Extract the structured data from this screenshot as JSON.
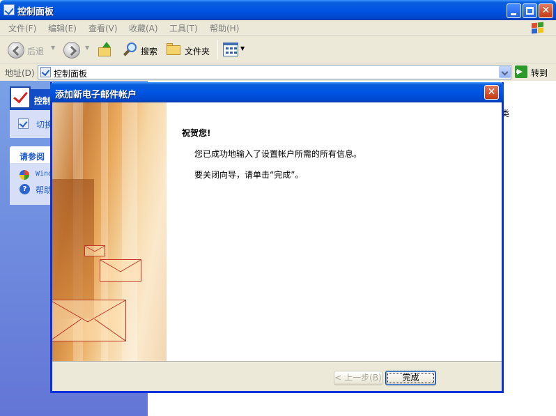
{
  "window": {
    "title": "控制面板"
  },
  "menu": {
    "items": [
      "文件(F)",
      "编辑(E)",
      "查看(V)",
      "收藏(A)",
      "工具(T)",
      "帮助(H)"
    ]
  },
  "toolbar": {
    "back_label": "后退",
    "search_label": "搜索",
    "folders_label": "文件夹"
  },
  "address": {
    "label": "地址(D)",
    "value": "控制面板",
    "go_label": "转到"
  },
  "left_pane": {
    "panel_title": "控制",
    "switch_text": "切换",
    "see_also_title": "请参阅",
    "see_also_items": [
      "Wind",
      "帮助"
    ]
  },
  "right_pane": {
    "fragment_text": "类"
  },
  "dialog": {
    "title": "添加新电子邮件帐户",
    "close_glyph": "✕",
    "congrats": "祝贺您!",
    "message1": "您已成功地输入了设置帐户所需的所有信息。",
    "message2": "要关闭向导，请单击“完成”。",
    "back_button": "< 上一步(B)",
    "finish_button": "完成"
  },
  "icons": {
    "title_icon": "control-panel-icon",
    "back": "back-arrow-icon",
    "forward": "forward-arrow-icon",
    "up": "folder-up-icon",
    "search": "search-icon",
    "folders": "folders-icon",
    "views": "views-icon",
    "go": "go-arrow-icon",
    "windows_flag": "windows-logo-icon"
  },
  "colors": {
    "titlebar": "#0054e3",
    "toolbar_bg": "#ece9d8",
    "left_pane": "#6f8fde",
    "link": "#215dc6"
  }
}
